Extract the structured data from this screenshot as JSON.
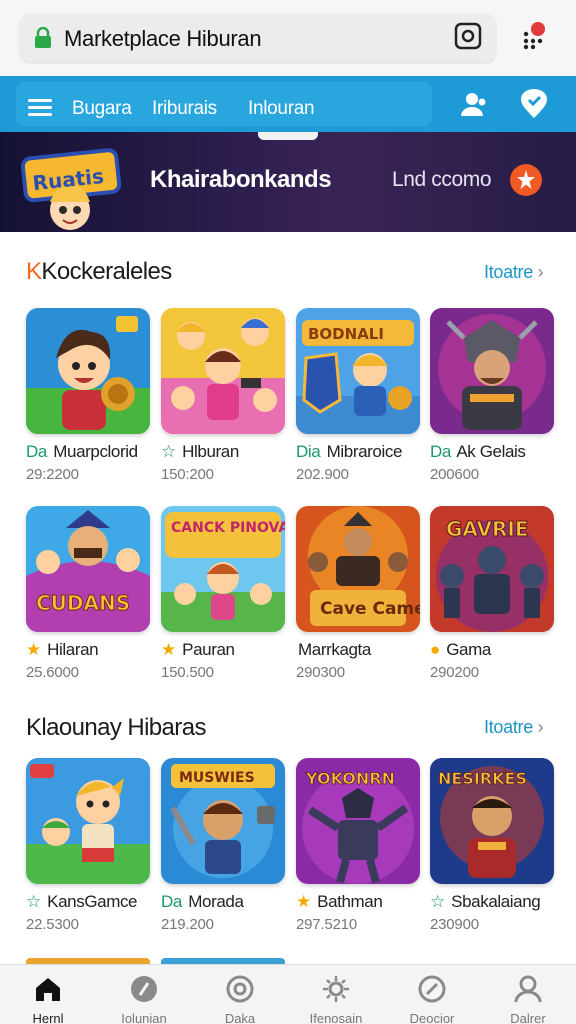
{
  "browser": {
    "url": "Marketplace Hiburan"
  },
  "nav": {
    "links": [
      "Bugara",
      "Iriburais",
      "Inlouran"
    ]
  },
  "banner": {
    "logo_text": "Ruatis",
    "title": "Khairabonkands",
    "link": "Lnd ccomo"
  },
  "sections": [
    {
      "title": "Kockeraleles",
      "more": "Itoatre",
      "items": [
        {
          "tag": "Da",
          "name": "Muarpclorid",
          "price": "29:2200"
        },
        {
          "tag": "☆",
          "name": "Hlburan",
          "price": "150:200"
        },
        {
          "tag": "Dia",
          "name": "Mibraroice",
          "price": "202.900"
        },
        {
          "tag": "Da",
          "name": "Ak Gelais",
          "price": "200600"
        }
      ]
    },
    {
      "title": "",
      "more": "",
      "items": [
        {
          "tag": "★",
          "name": "Hilaran",
          "price": "25.6000"
        },
        {
          "tag": "★",
          "name": "Pauran",
          "price": "150.500"
        },
        {
          "tag": "",
          "name": "Marrkagta",
          "price": "290300"
        },
        {
          "tag": "●",
          "name": "Gama",
          "price": "290200"
        }
      ]
    },
    {
      "title": "Klaounay Hibaras",
      "more": "Itoatre",
      "items": [
        {
          "tag": "☆",
          "name": "KansGamce",
          "price": "22.5300"
        },
        {
          "tag": "Da",
          "name": "Morada",
          "price": "219.200"
        },
        {
          "tag": "★",
          "name": "Bathman",
          "price": "297.5210"
        },
        {
          "tag": "☆",
          "name": "Sbakalaiang",
          "price": "230900"
        }
      ]
    }
  ],
  "thumb_texts": {
    "row1_3": "BODNALI",
    "row2_1": "CUDANS",
    "row2_2": "CANCK PINOVAID!",
    "row2_3": "Cave Cames",
    "row2_4": "GAVRIE",
    "row3_2": "MUSWIES",
    "row3_3": "YOKONRN",
    "row3_4": "NESIRKES"
  },
  "bottom_nav": [
    {
      "label": "Hernl",
      "icon": "home-icon",
      "active": true
    },
    {
      "label": "Iolunian",
      "icon": "badge-icon",
      "active": false
    },
    {
      "label": "Daka",
      "icon": "circle-icon",
      "active": false
    },
    {
      "label": "Ifenosain",
      "icon": "settings-icon",
      "active": false
    },
    {
      "label": "Deocior",
      "icon": "compass-icon",
      "active": false
    },
    {
      "label": "Dalrer",
      "icon": "profile-icon",
      "active": false
    }
  ],
  "colors": {
    "nav_blue": "#1e9ad6",
    "accent_orange": "#f15a24",
    "link_blue": "#1c94c4"
  }
}
